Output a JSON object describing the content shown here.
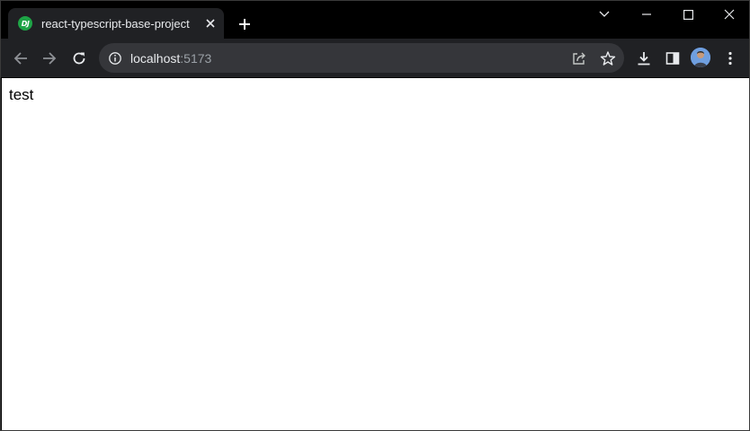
{
  "tab": {
    "title": "react-typescript-base-project",
    "favicon_text": "DJ"
  },
  "address_bar": {
    "host": "localhost",
    "port": ":5173"
  },
  "page": {
    "body_text": "test"
  },
  "colors": {
    "tabstrip": "#000000",
    "toolbar": "#202124",
    "omnibox": "#35363a",
    "favicon": "#1ea446",
    "page_background": "#ffffff"
  },
  "icons": {
    "tab_close": "close-icon",
    "new_tab": "plus-icon",
    "tab_search": "chevron-down-icon",
    "minimize": "minimize-icon",
    "maximize": "maximize-icon",
    "window_close": "close-icon",
    "back": "arrow-left-icon",
    "forward": "arrow-right-icon",
    "reload": "reload-icon",
    "site_info": "info-icon",
    "share": "share-icon",
    "bookmark": "star-icon",
    "downloads": "download-icon",
    "side_panel": "side-panel-icon",
    "profile": "avatar",
    "menu": "kebab-menu-icon"
  }
}
